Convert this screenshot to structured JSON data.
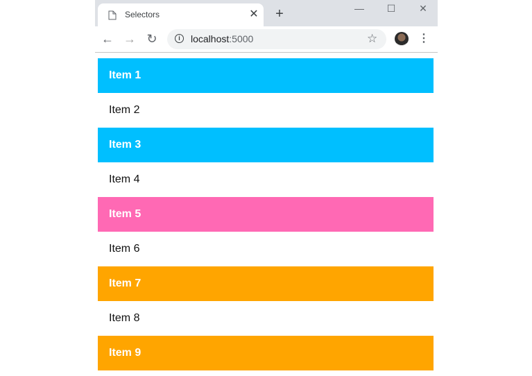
{
  "browser": {
    "tab": {
      "title": "Selectors",
      "icon": "page-icon",
      "close_glyph": "✕"
    },
    "new_tab_glyph": "+",
    "window_controls": {
      "minimize": "—",
      "maximize": "☐",
      "close": "✕"
    },
    "nav": {
      "back": "←",
      "forward": "→",
      "reload": "↻"
    },
    "address": {
      "host": "localhost",
      "port": ":5000",
      "info_glyph": "i"
    },
    "star_glyph": "☆",
    "menu_glyph": "⋮"
  },
  "colors": {
    "blue": "#00bfff",
    "pink": "#ff69b4",
    "orange": "#ffa500",
    "plain": "#ffffff"
  },
  "items": [
    {
      "label": "Item 1",
      "style": "blue"
    },
    {
      "label": "Item 2",
      "style": "plain"
    },
    {
      "label": "Item 3",
      "style": "blue"
    },
    {
      "label": "Item 4",
      "style": "plain"
    },
    {
      "label": "Item 5",
      "style": "pink"
    },
    {
      "label": "Item 6",
      "style": "plain"
    },
    {
      "label": "Item 7",
      "style": "orange"
    },
    {
      "label": "Item 8",
      "style": "plain"
    },
    {
      "label": "Item 9",
      "style": "orange"
    }
  ]
}
